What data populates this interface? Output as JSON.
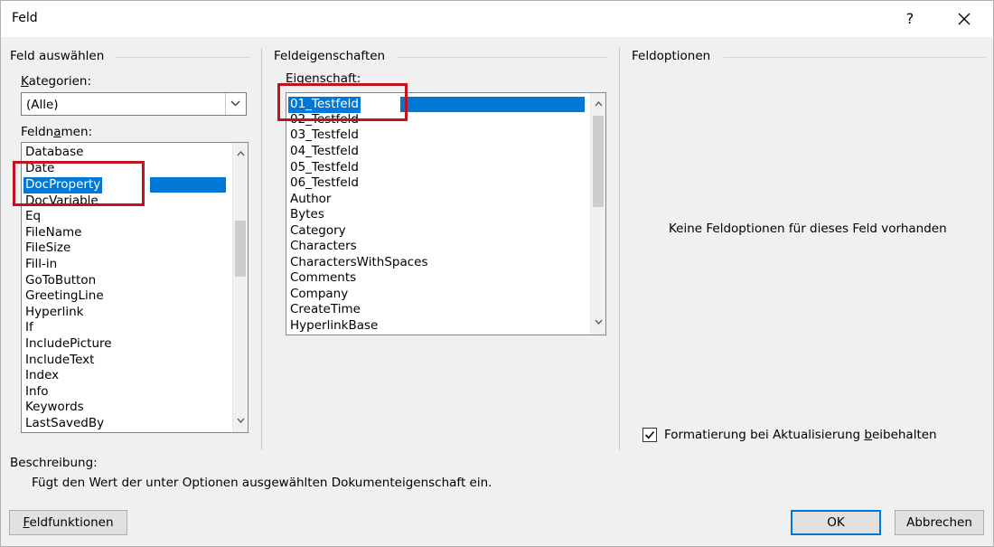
{
  "window": {
    "title": "Feld",
    "help_label": "?"
  },
  "select_field": {
    "section_title": "Feld auswählen",
    "categories_label_accel": "K",
    "categories_label_rest": "ategorien:",
    "category_value": "(Alle)",
    "fieldnames_label_pre": "Feldn",
    "fieldnames_label_accel": "a",
    "fieldnames_label_rest": "men:",
    "field_names": [
      "Database",
      "Date",
      "DocProperty",
      "DocVariable",
      "Eq",
      "FileName",
      "FileSize",
      "Fill-in",
      "GoToButton",
      "GreetingLine",
      "Hyperlink",
      "If",
      "IncludePicture",
      "IncludeText",
      "Index",
      "Info",
      "Keywords",
      "LastSavedBy"
    ],
    "selected": "DocProperty"
  },
  "field_properties": {
    "section_title": "Feldeigenschaften",
    "sublabel": "Eigenschaft:",
    "properties": [
      "01_Testfeld",
      "02_Testfeld",
      "03_Testfeld",
      "04_Testfeld",
      "05_Testfeld",
      "06_Testfeld",
      "Author",
      "Bytes",
      "Category",
      "Characters",
      "CharactersWithSpaces",
      "Comments",
      "Company",
      "CreateTime",
      "HyperlinkBase"
    ],
    "selected": "01_Testfeld"
  },
  "field_options": {
    "section_title": "Feldoptionen",
    "empty_message": "Keine Feldoptionen für dieses Feld vorhanden",
    "preserve_format_pre": "Formatierung bei Aktualisierung ",
    "preserve_format_accel": "b",
    "preserve_format_rest": "eibehalten",
    "preserve_format_checked": true
  },
  "description": {
    "label": "Beschreibung:",
    "text": "Fügt den Wert der unter Optionen ausgewählten Dokumenteigenschaft ein."
  },
  "buttons": {
    "field_codes_accel": "F",
    "field_codes_rest": "eldfunktionen",
    "ok": "OK",
    "cancel": "Abbrechen"
  },
  "colors": {
    "selection": "#0078d7",
    "highlight_box": "#c0121f",
    "dialog_bg": "#f0f0f0"
  },
  "icons": {
    "close": "close-icon",
    "dropdown": "chevron-down-icon",
    "scroll_up": "chevron-up-icon",
    "scroll_down": "chevron-down-icon",
    "check": "checkmark-icon"
  }
}
